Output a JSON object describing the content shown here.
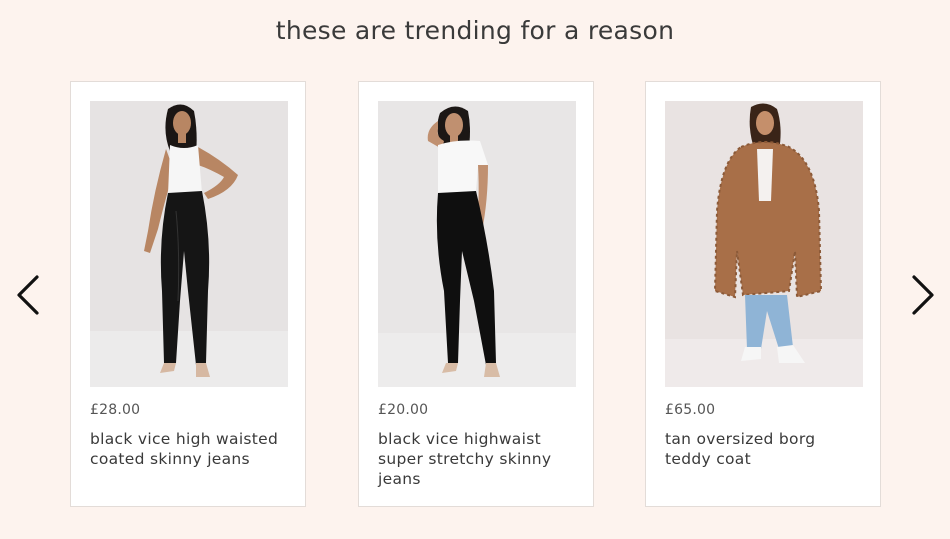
{
  "section": {
    "heading": "these are trending for a reason"
  },
  "carousel": {
    "prev_icon": "chevron-left-icon",
    "next_icon": "chevron-right-icon"
  },
  "products": [
    {
      "price": "£28.00",
      "title": "black vice high waisted coated skinny jeans"
    },
    {
      "price": "£20.00",
      "title": "black vice highwaist super stretchy skinny jeans"
    },
    {
      "price": "£65.00",
      "title": "tan oversized borg teddy coat"
    }
  ],
  "colors": {
    "background": "#fdf3ee",
    "card": "#ffffff",
    "text": "#3a3a3a"
  }
}
